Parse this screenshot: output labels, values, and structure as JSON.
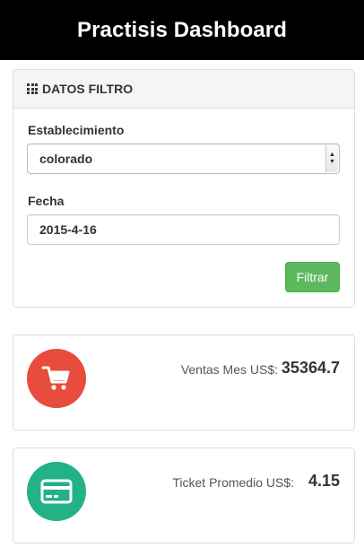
{
  "header": {
    "title": "Practisis Dashboard"
  },
  "filter_panel": {
    "title": "DATOS FILTRO",
    "icon": "th-grid-icon",
    "establecimiento_label": "Establecimiento",
    "establecimiento_value": "colorado",
    "fecha_label": "Fecha",
    "fecha_value": "2015-4-16",
    "filter_button": "Filtrar"
  },
  "stats": [
    {
      "label": "Ventas Mes US$:",
      "value": "35364.7",
      "icon": "shopping-cart-icon",
      "color": "#e74c3c"
    },
    {
      "label": "Ticket Promedio US$:",
      "value": "4.15",
      "icon": "credit-card-icon",
      "color": "#23b186"
    }
  ]
}
